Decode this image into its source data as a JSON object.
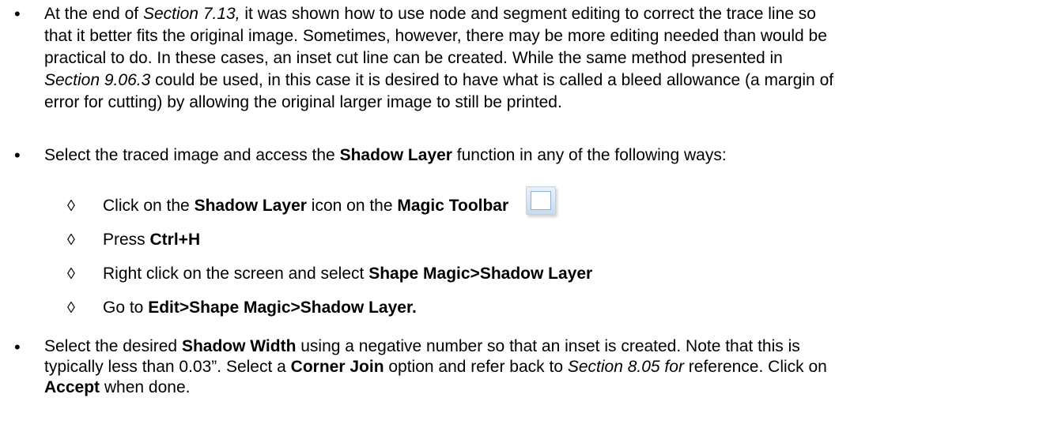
{
  "bullet1": {
    "t1": "At the end of ",
    "t2": "Section 7.13,",
    "t3": " it was shown how to use node and segment editing to correct the trace line so",
    "t4": "that it better fits the original image. Sometimes, however, there may be more editing needed than would be",
    "t5": "practical to do.  In these cases, an inset cut line can be created.  While the same method presented in",
    "t6": "Section 9.06.3",
    "t7": " could be used, in this case it is desired to have what is called a bleed allowance (a margin of",
    "t8": "error for cutting) by allowing the original larger image to still be printed."
  },
  "bullet2": {
    "t1": "Select the traced image and access the ",
    "t2": "Shadow Layer",
    "t3": " function in any of the following ways:"
  },
  "sub_items": {
    "marker": "◊",
    "a1": "Click on the ",
    "a2": "Shadow Layer",
    "a3": " icon on the ",
    "a4": "Magic Toolbar",
    "b1": "Press ",
    "b2": "Ctrl+H",
    "c1": "Right click on the screen and select ",
    "c2": "Shape Magic>Shadow Layer",
    "d1": "Go to ",
    "d2": "Edit>Shape Magic>Shadow Layer."
  },
  "bullet3": {
    "t1": "Select the desired ",
    "t2": "Shadow Width",
    "t3": " using a negative number so that an inset is created. Note that this is",
    "t4": "typically less than 0.03”.  Select a ",
    "t5": "Corner Join",
    "t6": " option and refer back to ",
    "t7": "Section 8.05 for",
    "t8": " reference.  Click on",
    "t9": "Accept",
    "t10": " when done."
  },
  "bullet_marker": "•"
}
